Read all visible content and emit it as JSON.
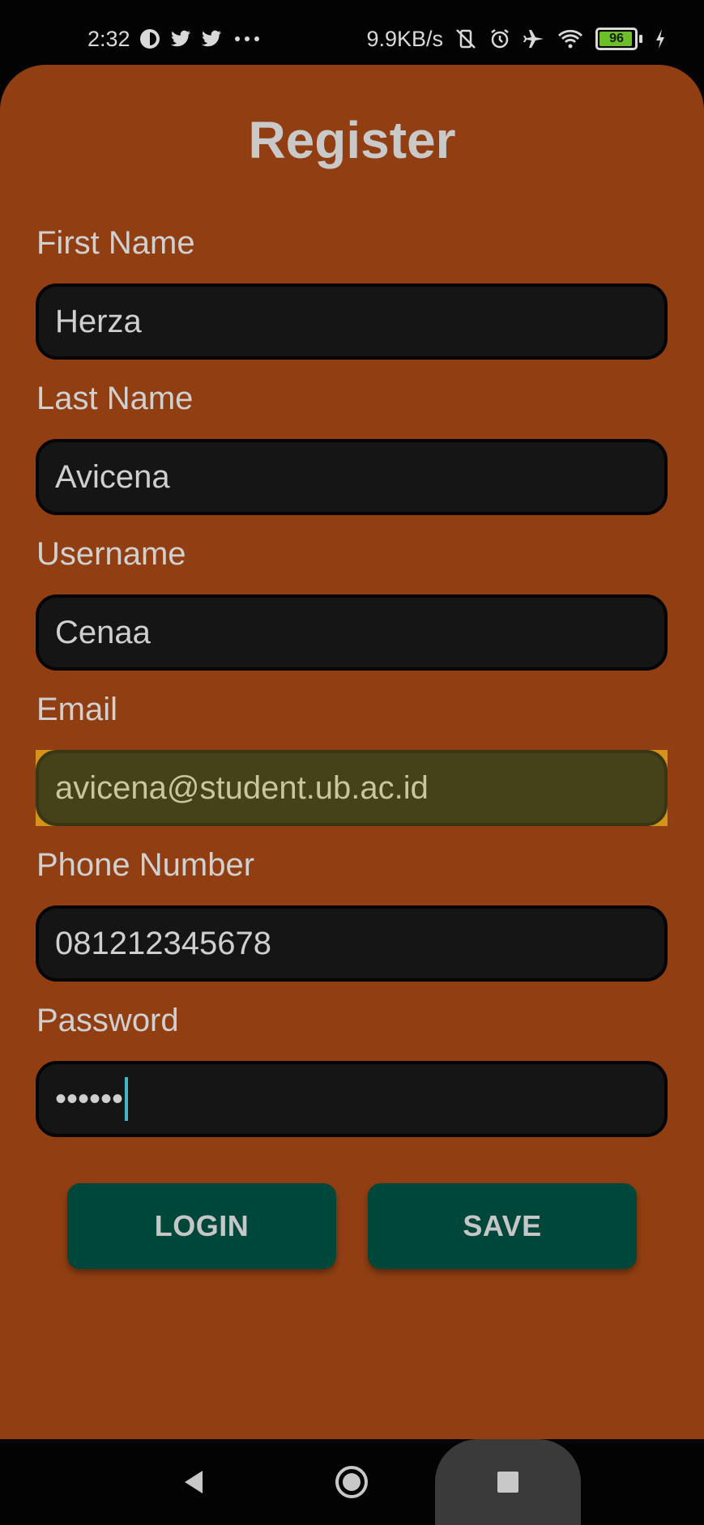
{
  "status_bar": {
    "time": "2:32",
    "speed": "9.9KB/s",
    "battery": "96",
    "battery_fraction": 0.96
  },
  "form": {
    "title": "Register",
    "fields": [
      {
        "label": "First Name",
        "value": "Herza"
      },
      {
        "label": "Last Name",
        "value": "Avicena"
      },
      {
        "label": "Username",
        "value": "Cenaa"
      },
      {
        "label": "Email",
        "value": "avicena@student.ub.ac.id"
      },
      {
        "label": "Phone Number",
        "value": "081212345678"
      },
      {
        "label": "Password",
        "value": "••••••"
      }
    ],
    "login_label": "LOGIN",
    "save_label": "SAVE"
  },
  "icons": {
    "status": [
      "notification-app-icon",
      "twitter-icon",
      "twitter-icon",
      "more-icon",
      "vibrate-off-icon",
      "alarm-icon",
      "airplane-icon",
      "wifi-icon",
      "battery-icon",
      "charging-icon"
    ],
    "nav": [
      "back-icon",
      "home-icon",
      "recents-icon"
    ]
  },
  "colors": {
    "sheet_background": "#913f12",
    "input_background": "#151515",
    "email_highlight": "#d4941a",
    "button_background": "#00473b",
    "cursor": "#3fb8c4"
  }
}
